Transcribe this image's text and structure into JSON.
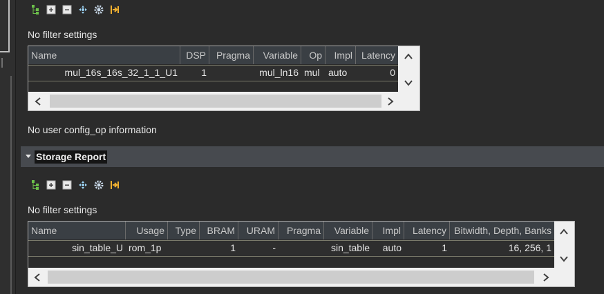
{
  "toolbar_icons": [
    "tree-expand-icon",
    "expand-all-icon",
    "collapse-all-icon",
    "move-icon",
    "settings-gear-icon",
    "export-icon"
  ],
  "binding_section": {
    "filter_text": "No filter settings",
    "columns": [
      "Name",
      "DSP",
      "Pragma",
      "Variable",
      "Op",
      "Impl",
      "Latency"
    ],
    "rows": [
      {
        "name": "mul_16s_16s_32_1_1_U1",
        "dsp": "1",
        "pragma": "",
        "variable": "mul_ln16",
        "op": "mul",
        "impl": "auto",
        "latency": "0"
      }
    ]
  },
  "config_op_text": "No user config_op information",
  "storage_section": {
    "title": "Storage Report",
    "filter_text": "No filter settings",
    "columns": [
      "Name",
      "Usage",
      "Type",
      "BRAM",
      "URAM",
      "Pragma",
      "Variable",
      "Impl",
      "Latency",
      "Bitwidth, Depth, Banks"
    ],
    "rows": [
      {
        "name": "sin_table_U",
        "usage": "rom_1p",
        "type": "",
        "bram": "1",
        "uram": "-",
        "pragma": "",
        "variable": "sin_table",
        "impl": "auto",
        "latency": "1",
        "bitwidth": "16, 256, 1"
      }
    ]
  }
}
